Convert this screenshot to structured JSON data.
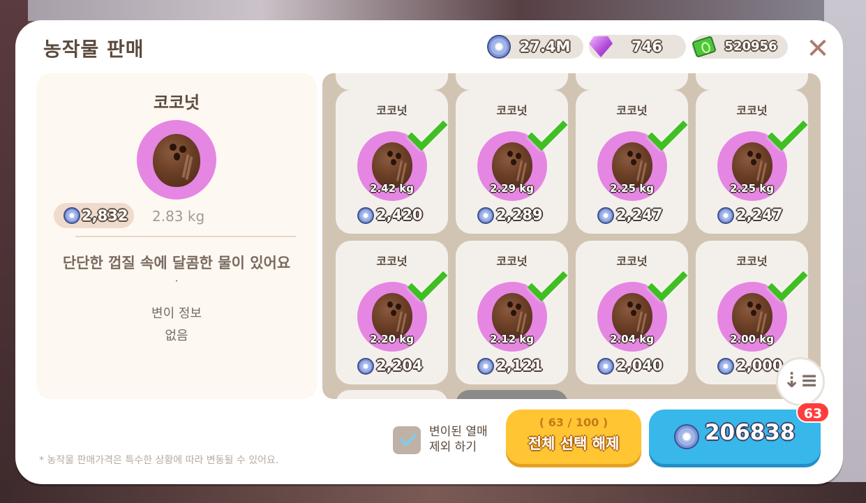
{
  "header": {
    "title": "농작물 판매",
    "coins": "27.4M",
    "gems": "746",
    "cash": "520956",
    "close_icon": "close-icon"
  },
  "detail": {
    "name": "코코넛",
    "price": "2,832",
    "weight": "2.83 kg",
    "description": "단단한 껍질 속에 달콤한 물이 있어요",
    "separator": "·",
    "mutation_title": "변이 정보",
    "mutation_value": "없음"
  },
  "grid": {
    "items": [
      {
        "name": "코코넛",
        "weight": "2.42 kg",
        "price": "2,420",
        "selected": true
      },
      {
        "name": "코코넛",
        "weight": "2.29 kg",
        "price": "2,289",
        "selected": true
      },
      {
        "name": "코코넛",
        "weight": "2.25 kg",
        "price": "2,247",
        "selected": true
      },
      {
        "name": "코코넛",
        "weight": "2.25 kg",
        "price": "2,247",
        "selected": true
      },
      {
        "name": "코코넛",
        "weight": "2.20 kg",
        "price": "2,204",
        "selected": true
      },
      {
        "name": "코코넛",
        "weight": "2.12 kg",
        "price": "2,121",
        "selected": true
      },
      {
        "name": "코코넛",
        "weight": "2.04 kg",
        "price": "2,040",
        "selected": true
      },
      {
        "name": "코코넛",
        "weight": "2.00 kg",
        "price": "2,000",
        "selected": true
      }
    ],
    "sort_icon": "sort-descending-icon"
  },
  "footer": {
    "exclude_label_line1": "변이된 열매",
    "exclude_label_line2": "제외 하기",
    "exclude_checked": true,
    "note": "* 농작물 판매가격은 특수한 상황에 따라 변동될 수 있어요.",
    "select_count": "( 63 / 100 )",
    "deselect_all_label": "전체 선택 해제",
    "sell_total": "206838",
    "badge_count": "63"
  },
  "colors": {
    "accent_yellow": "#ffc533",
    "accent_blue": "#37b7ea",
    "bubble_pink": "#e586e3",
    "check_green": "#3fbf22",
    "badge_red": "#ff3d3d"
  }
}
